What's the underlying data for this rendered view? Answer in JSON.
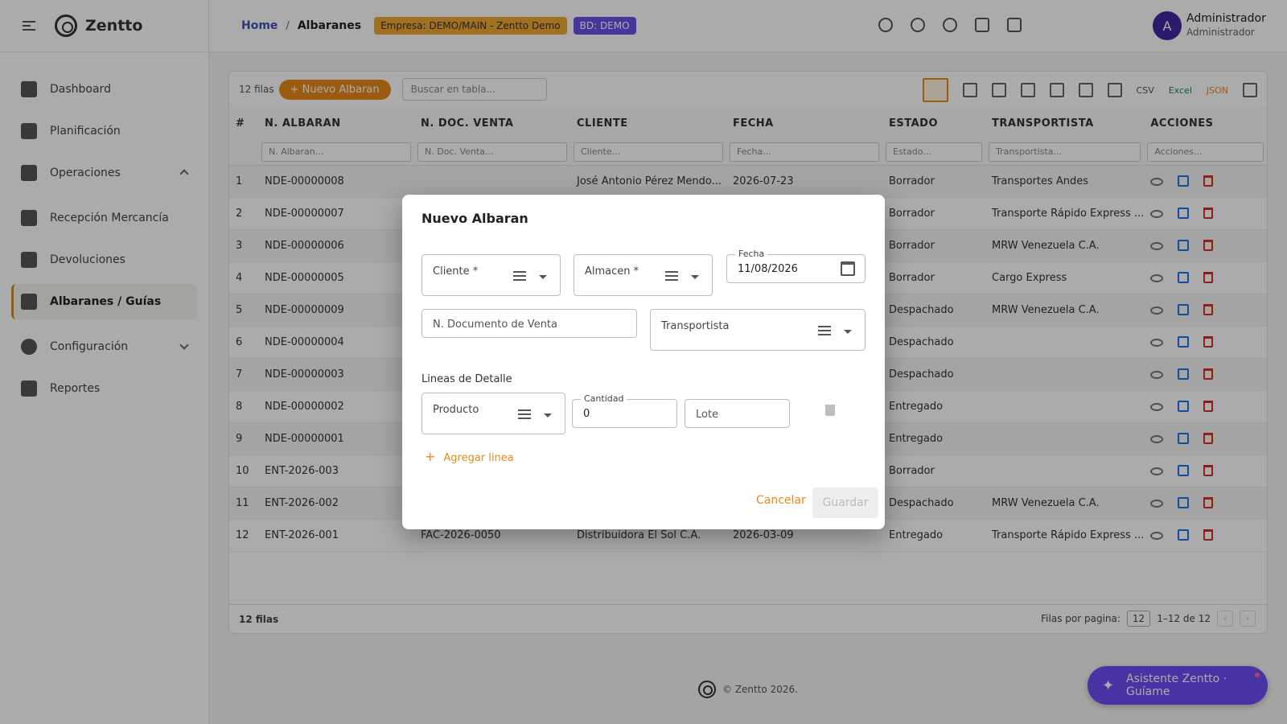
{
  "app": {
    "brand": "Zentto"
  },
  "sidebar": {
    "items": [
      {
        "label": "Dashboard"
      },
      {
        "label": "Planificación"
      },
      {
        "label": "Operaciones"
      },
      {
        "label": "Recepción Mercancía"
      },
      {
        "label": "Devoluciones"
      },
      {
        "label": "Albaranes / Guías"
      },
      {
        "label": "Configuración"
      },
      {
        "label": "Reportes"
      }
    ]
  },
  "header": {
    "breadcrumb_home": "Home",
    "breadcrumb_sep": "/",
    "breadcrumb_current": "Albaranes",
    "company_badge": "Empresa: DEMO/MAIN - Zentto Demo",
    "db_badge": "BD: DEMO",
    "avatar_initial": "A",
    "user_name": "Administrador",
    "user_role": "Administrador"
  },
  "toolbar": {
    "row_count": "12 filas",
    "new_button": "+ Nuevo Albaran",
    "search_placeholder": "Buscar en tabla...",
    "csv_label": "CSV",
    "excel_label": "Excel",
    "json_label": "JSON"
  },
  "table": {
    "columns": [
      "#",
      "N. ALBARAN",
      "N. DOC. VENTA",
      "CLIENTE",
      "FECHA",
      "ESTADO",
      "TRANSPORTISTA",
      "ACCIONES"
    ],
    "filters": [
      "N. Albaran...",
      "N. Doc. Venta...",
      "Cliente...",
      "Fecha...",
      "Estado...",
      "Transportista...",
      "Acciones..."
    ],
    "rows": [
      {
        "n": "1",
        "albaran": "NDE-00000008",
        "doc": "",
        "cliente": "José Antonio Pérez Mendo...",
        "fecha": "2026-07-23",
        "estado": "Borrador",
        "transportista": "Transportes Andes"
      },
      {
        "n": "2",
        "albaran": "NDE-00000007",
        "doc": "",
        "cliente": "",
        "fecha": "",
        "estado": "Borrador",
        "transportista": "Transporte Rápido Express ..."
      },
      {
        "n": "3",
        "albaran": "NDE-00000006",
        "doc": "",
        "cliente": "",
        "fecha": "",
        "estado": "Borrador",
        "transportista": "MRW Venezuela C.A."
      },
      {
        "n": "4",
        "albaran": "NDE-00000005",
        "doc": "",
        "cliente": "",
        "fecha": "",
        "estado": "Borrador",
        "transportista": "Cargo Express"
      },
      {
        "n": "5",
        "albaran": "NDE-00000009",
        "doc": "",
        "cliente": "",
        "fecha": "",
        "estado": "Despachado",
        "transportista": "MRW Venezuela C.A."
      },
      {
        "n": "6",
        "albaran": "NDE-00000004",
        "doc": "",
        "cliente": "",
        "fecha": "",
        "estado": "Despachado",
        "transportista": ""
      },
      {
        "n": "7",
        "albaran": "NDE-00000003",
        "doc": "",
        "cliente": "",
        "fecha": "",
        "estado": "Despachado",
        "transportista": ""
      },
      {
        "n": "8",
        "albaran": "NDE-00000002",
        "doc": "",
        "cliente": "",
        "fecha": "",
        "estado": "Entregado",
        "transportista": ""
      },
      {
        "n": "9",
        "albaran": "NDE-00000001",
        "doc": "",
        "cliente": "",
        "fecha": "",
        "estado": "Entregado",
        "transportista": ""
      },
      {
        "n": "10",
        "albaran": "ENT-2026-003",
        "doc": "",
        "cliente": "",
        "fecha": "",
        "estado": "Borrador",
        "transportista": ""
      },
      {
        "n": "11",
        "albaran": "ENT-2026-002",
        "doc": "",
        "cliente": "",
        "fecha": "",
        "estado": "Despachado",
        "transportista": "MRW Venezuela C.A."
      },
      {
        "n": "12",
        "albaran": "ENT-2026-001",
        "doc": "FAC-2026-0050",
        "cliente": "Distribuidora El Sol C.A.",
        "fecha": "2026-03-09",
        "estado": "Entregado",
        "transportista": "Transporte Rápido Express ..."
      }
    ]
  },
  "footer": {
    "rows_label": "12 filas",
    "per_page_label": "Filas por pagina:",
    "per_page_value": "12",
    "range": "1–12 de 12",
    "prev": "‹",
    "next": "›",
    "copyright": "© Zentto 2026."
  },
  "assistant": {
    "label": "Asistente Zentto · Guíame"
  },
  "modal": {
    "title": "Nuevo Albaran",
    "cliente_label": "Cliente *",
    "almacen_label": "Almacen *",
    "fecha_label": "Fecha",
    "fecha_value": "11/08/2026",
    "doc_venta_placeholder": "N. Documento de Venta",
    "transportista_label": "Transportista",
    "lines_section": "Lineas de Detalle",
    "producto_label": "Producto",
    "cantidad_label": "Cantidad",
    "cantidad_value": "0",
    "lote_placeholder": "Lote",
    "add_line": "Agregar linea",
    "cancel": "Cancelar",
    "save": "Guardar"
  }
}
